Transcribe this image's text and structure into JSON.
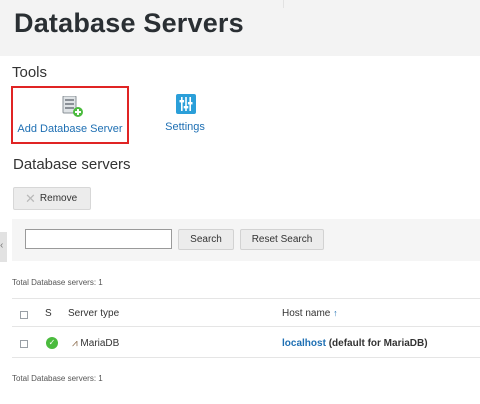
{
  "page": {
    "title": "Database Servers"
  },
  "tools": {
    "heading": "Tools",
    "items": [
      {
        "label": "Add Database Server",
        "icon": "database-add-icon"
      },
      {
        "label": "Settings",
        "icon": "settings-sliders-icon"
      }
    ]
  },
  "servers": {
    "heading": "Database servers",
    "remove_label": "Remove",
    "search": {
      "value": "",
      "placeholder": "",
      "search_label": "Search",
      "reset_label": "Reset Search"
    },
    "total_top": "Total Database servers: 1",
    "total_bottom": "Total Database servers: 1",
    "columns": {
      "status": "S",
      "server_type": "Server type",
      "host_name": "Host name",
      "sort_arrow": "↑"
    },
    "rows": [
      {
        "server_type": "MariaDB",
        "host_link": "localhost",
        "host_note": "(default for MariaDB)",
        "status": "ok"
      }
    ]
  },
  "colors": {
    "link": "#1e6fb3",
    "highlight": "#e02424",
    "status_ok": "#4bbb3e"
  }
}
